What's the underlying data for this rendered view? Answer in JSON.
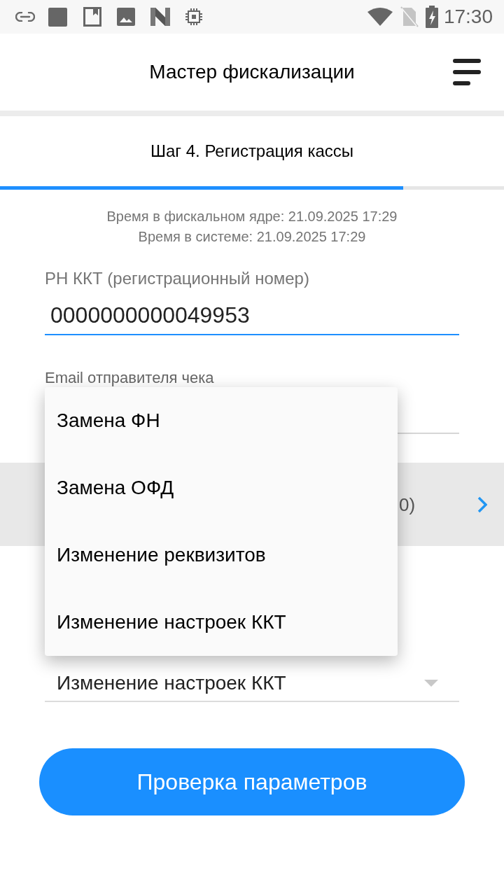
{
  "status_bar": {
    "time": "17:30"
  },
  "app_bar": {
    "title": "Мастер фискализации"
  },
  "step": {
    "title": "Шаг 4. Регистрация кассы",
    "level": 0.8
  },
  "time_info": [
    "Время в фискальном ядре: 21.09.2025 17:29",
    "Время в системе: 21.09.2025 17:29"
  ],
  "fields": [
    {
      "label": "РН ККТ (регистрационный номер)",
      "value": "0000000000049953",
      "focused": true
    },
    {
      "label": "Email отправителя чека",
      "focused": false
    }
  ],
  "list_row": {
    "partial_text": "0)"
  },
  "spinner": {
    "value": "Изменение настроек ККТ"
  },
  "popup_menu": {
    "items": [
      "Замена ФН",
      "Замена ОФД",
      "Изменение реквизитов",
      "Изменение настроек ККТ"
    ]
  },
  "primary_button": {
    "label": "Проверка параметров"
  }
}
